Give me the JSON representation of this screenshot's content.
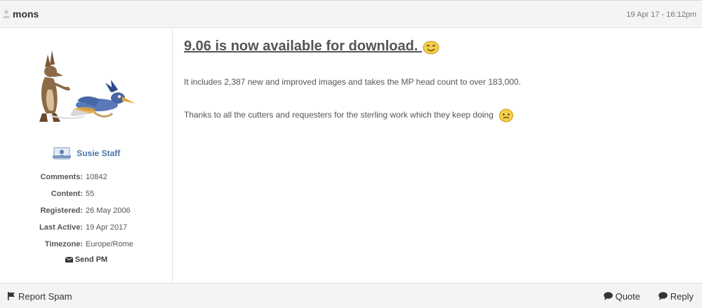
{
  "post": {
    "username": "mons",
    "date": "19 Apr 17 - 16:12pm"
  },
  "profile": {
    "group": "Susie Staff",
    "stats": [
      {
        "label": "Comments:",
        "value": "10842"
      },
      {
        "label": "Content:",
        "value": "55"
      },
      {
        "label": "Registered:",
        "value": "26 May 2006"
      },
      {
        "label": "Last Active:",
        "value": "19 Apr 2017"
      },
      {
        "label": "Timezone:",
        "value": "Europe/Rome"
      }
    ],
    "send_pm": "Send PM"
  },
  "content": {
    "title": "9.06 is now available for download.",
    "paragraphs": [
      "It includes 2,387 new and improved images and takes the MP head count to over 183,000.",
      "Thanks to all the cutters and requesters for the sterling work which they keep doing"
    ]
  },
  "footer": {
    "report": "Report Spam",
    "quote": "Quote",
    "reply": "Reply"
  },
  "icons": {
    "user": "user-icon",
    "group": "staff-badge-icon",
    "envelope": "envelope-icon",
    "flag": "flag-icon",
    "quote": "speech-bubble-icon",
    "reply": "speech-bubble-icon",
    "smiley": "smiley-icon"
  },
  "colors": {
    "header_bg": "#f4f4f4",
    "group_name": "#4b74a6",
    "text": "#555555"
  }
}
